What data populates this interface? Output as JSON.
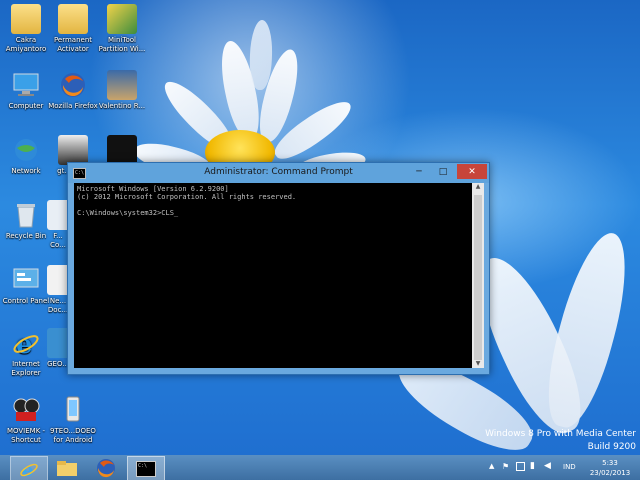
{
  "window": {
    "title": "Administrator: Command Prompt",
    "sys_icon_text": "C:\\",
    "minimize": "─",
    "maximize": "□",
    "close": "✕",
    "lines": [
      "Microsoft Windows [Version 6.2.9200]",
      "(c) 2012 Microsoft Corporation. All rights reserved.",
      "",
      "C:\\Windows\\system32>CLS_"
    ]
  },
  "desktop_icons": [
    {
      "label": "Cakra Amiyantoro",
      "icon": "folder-icon"
    },
    {
      "label": "Permanent Activator",
      "icon": "folder-icon"
    },
    {
      "label": "MiniTool Partition Wi...",
      "icon": "minitool-icon"
    },
    {
      "label": "Computer",
      "icon": "computer-icon"
    },
    {
      "label": "Mozilla Firefox",
      "icon": "firefox-icon"
    },
    {
      "label": "Valentino R...",
      "icon": "photo-icon"
    },
    {
      "label": "Network",
      "icon": "network-icon"
    },
    {
      "label": "gt... Sh...",
      "icon": "game-icon"
    },
    {
      "label": "",
      "icon": "photo-icon"
    },
    {
      "label": "Recycle Bin",
      "icon": "recycle-bin-icon"
    },
    {
      "label": "F... Co...",
      "icon": "file-icon"
    },
    {
      "label": "Control Panel",
      "icon": "control-panel-icon"
    },
    {
      "label": "Ne... Doc...",
      "icon": "document-icon"
    },
    {
      "label": "Internet Explorer",
      "icon": "internet-explorer-icon"
    },
    {
      "label": "GEO...",
      "icon": "geo-icon"
    },
    {
      "label": "MOVIEMK - Shortcut",
      "icon": "moviemaker-icon"
    },
    {
      "label": "9TEO...DOEO for Android",
      "icon": "android-icon"
    }
  ],
  "watermark": {
    "line1": "Windows 8 Pro with Media Center",
    "line2": "Build 9200"
  },
  "taskbar": {
    "language": "IND",
    "time": "5:33",
    "date": "23/02/2013",
    "items": [
      "internet-explorer-icon",
      "file-explorer-icon",
      "firefox-icon",
      "command-prompt-icon"
    ]
  }
}
